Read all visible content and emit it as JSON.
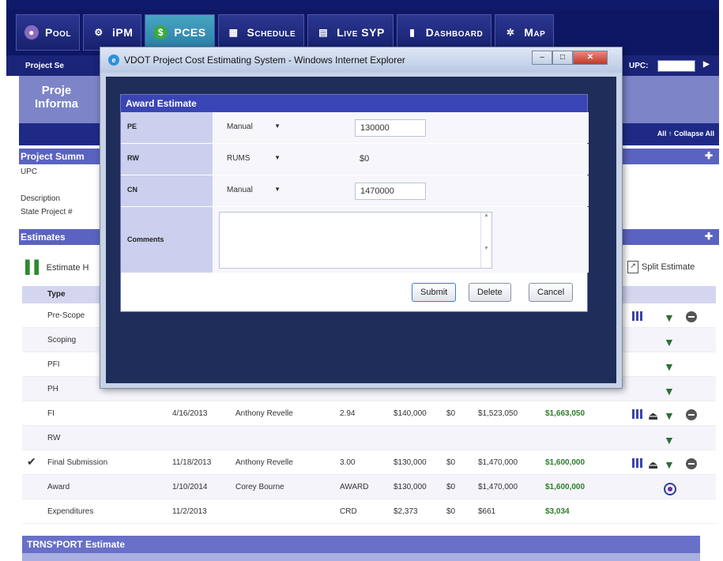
{
  "nav": {
    "tabs": [
      {
        "label": "Pool",
        "icon": "pool-icon"
      },
      {
        "label": "iPM",
        "icon": "gear-icon"
      },
      {
        "label": "PCES",
        "icon": "pces-icon"
      },
      {
        "label": "Schedule",
        "icon": "schedule-icon"
      },
      {
        "label": "Live SYP",
        "icon": "document-icon"
      },
      {
        "label": "Dashboard",
        "icon": "dashboard-icon"
      },
      {
        "label": "Map",
        "icon": "globe-icon"
      }
    ],
    "active_tab": "PCES"
  },
  "subnav": {
    "item": "Project Se",
    "upc_label": "UPC:",
    "arrow": "▶"
  },
  "project_info": {
    "label_line1": "Proje",
    "label_line2": "Informa"
  },
  "toolbar": {
    "collapse_all": "All ↑ Collapse All",
    "estimate_history": "Estimate H",
    "split_estimate": "Split Estimate"
  },
  "project_summary": {
    "title": "Project Summ",
    "fields": [
      "UPC",
      "Description",
      "State Project #"
    ]
  },
  "estimates": {
    "title": "Estimates",
    "type_header": "Type",
    "rows": [
      {
        "check": "",
        "type": "Pre-Scope",
        "date": "",
        "by": "",
        "ver": "",
        "pe": "",
        "rw": "",
        "cn": "",
        "total": "",
        "icons": [
          "grid",
          "funnel",
          "minus"
        ]
      },
      {
        "check": "",
        "type": "Scoping",
        "date": "",
        "by": "",
        "ver": "",
        "pe": "",
        "rw": "",
        "cn": "",
        "total": "",
        "icons": [
          "funnel"
        ]
      },
      {
        "check": "",
        "type": "PFI",
        "date": "",
        "by": "",
        "ver": "",
        "pe": "",
        "rw": "",
        "cn": "",
        "total": "",
        "icons": [
          "funnel"
        ]
      },
      {
        "check": "",
        "type": "PH",
        "date": "",
        "by": "",
        "ver": "",
        "pe": "",
        "rw": "",
        "cn": "",
        "total": "",
        "icons": [
          "funnel"
        ]
      },
      {
        "check": "",
        "type": "FI",
        "date": "4/16/2013",
        "by": "Anthony Revelle",
        "ver": "2.94",
        "pe": "$140,000",
        "rw": "$0",
        "cn": "$1,523,050",
        "total": "$1,663,050",
        "icons": [
          "grid",
          "print",
          "funnel",
          "minus"
        ]
      },
      {
        "check": "",
        "type": "RW",
        "date": "",
        "by": "",
        "ver": "",
        "pe": "",
        "rw": "",
        "cn": "",
        "total": "",
        "icons": [
          "funnel"
        ]
      },
      {
        "check": "✔",
        "type": "Final Submission",
        "date": "11/18/2013",
        "by": "Anthony Revelle",
        "ver": "3.00",
        "pe": "$130,000",
        "rw": "$0",
        "cn": "$1,470,000",
        "total": "$1,600,000",
        "icons": [
          "grid",
          "print",
          "funnel",
          "minus"
        ]
      },
      {
        "check": "",
        "type": "Award",
        "date": "1/10/2014",
        "by": "Corey Bourne",
        "ver": "AWARD",
        "pe": "$130,000",
        "rw": "$0",
        "cn": "$1,470,000",
        "total": "$1,600,000",
        "icons": [
          "award"
        ]
      },
      {
        "check": "",
        "type": "Expenditures",
        "date": "11/2/2013",
        "by": "",
        "ver": "CRD",
        "pe": "$2,373",
        "rw": "$0",
        "cn": "$661",
        "total": "$3,034",
        "icons": []
      }
    ]
  },
  "trns": {
    "title": "TRNS*PORT Estimate"
  },
  "popup": {
    "window_title": "VDOT Project Cost Estimating System - Windows Internet Explorer",
    "form_title": "Award Estimate",
    "pe": {
      "label": "PE",
      "method": "Manual",
      "value": "130000"
    },
    "rw": {
      "label": "RW",
      "method": "RUMS",
      "value": "$0"
    },
    "cn": {
      "label": "CN",
      "method": "Manual",
      "value": "1470000"
    },
    "comments": {
      "label": "Comments",
      "value": ""
    },
    "buttons": {
      "submit": "Submit",
      "delete": "Delete",
      "cancel": "Cancel"
    }
  }
}
